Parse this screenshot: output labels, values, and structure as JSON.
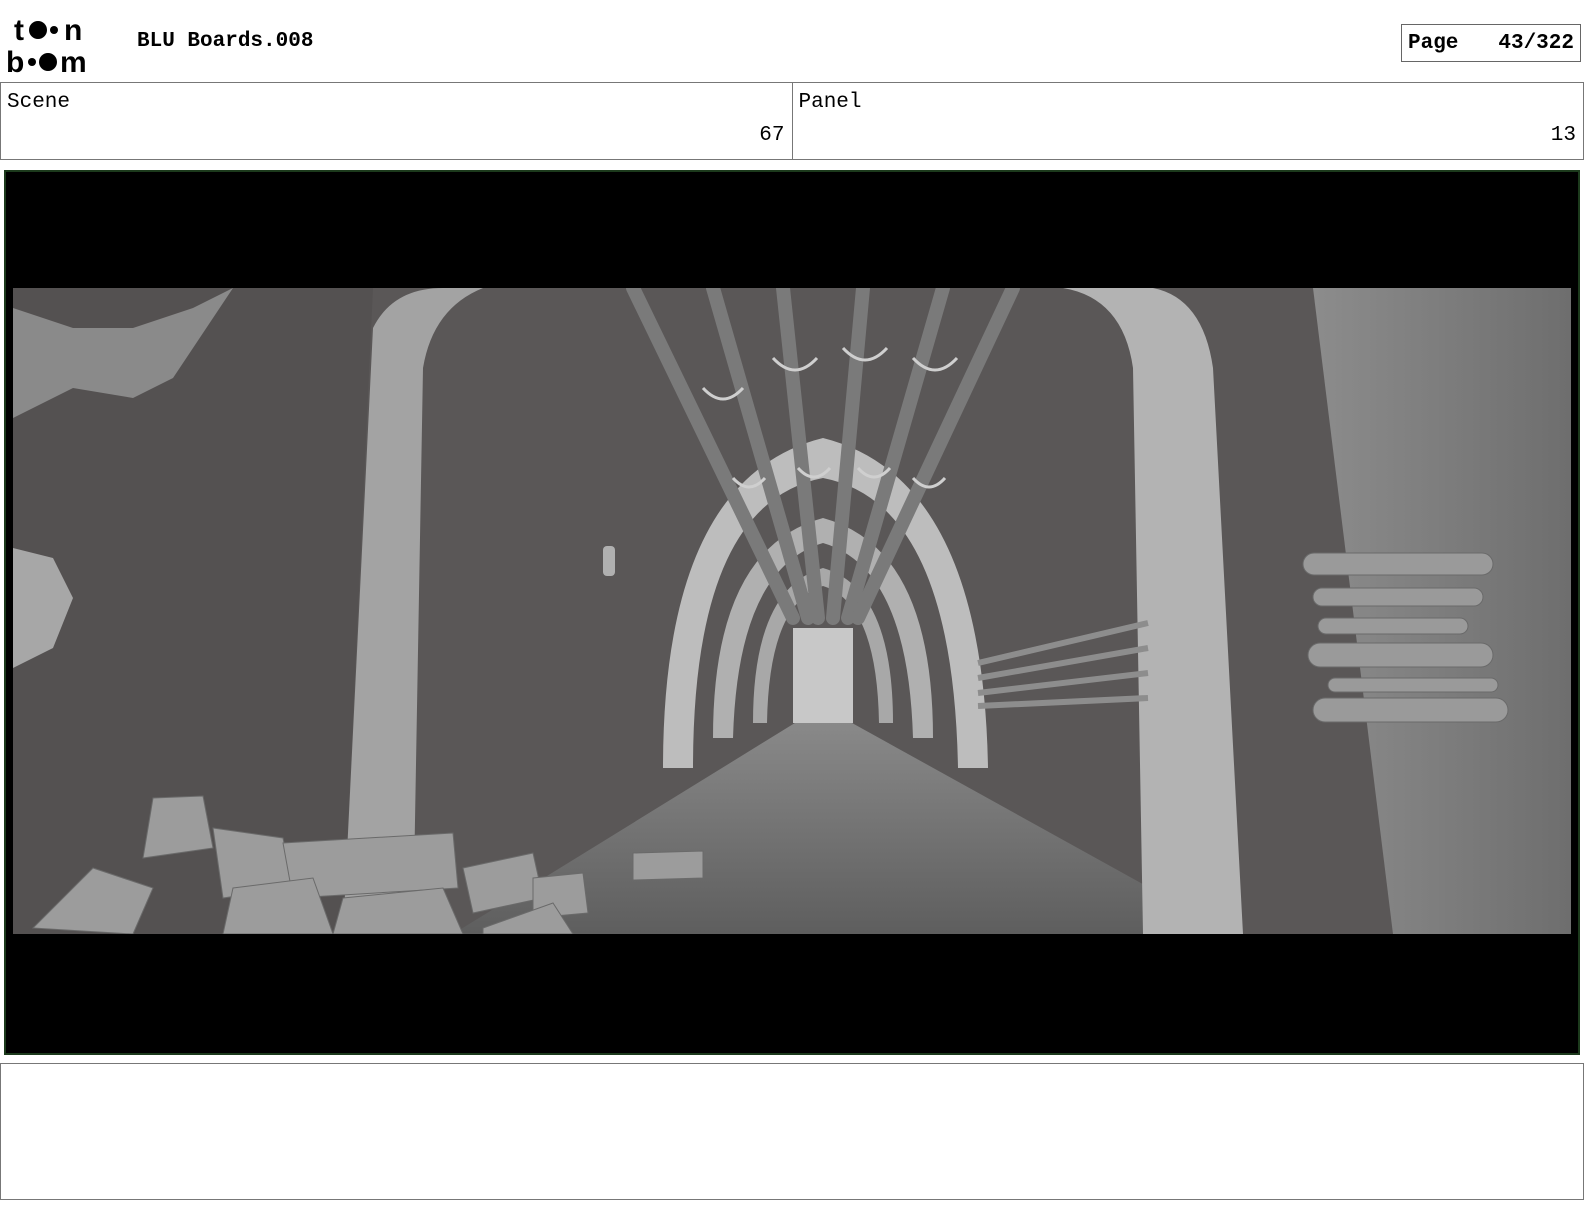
{
  "header": {
    "logo_text": "toon boom",
    "document_title": "BLU Boards.008",
    "page_label": "Page",
    "page_number": "43/322"
  },
  "info": {
    "scene_label": "Scene",
    "scene_value": "67",
    "panel_label": "Panel",
    "panel_value": "13"
  },
  "panel_image": {
    "description_icon": "storyboard-frame-image",
    "letterbox_color": "#000000",
    "frame_border_color": "#1c3a1c"
  },
  "notes": {
    "text": ""
  }
}
